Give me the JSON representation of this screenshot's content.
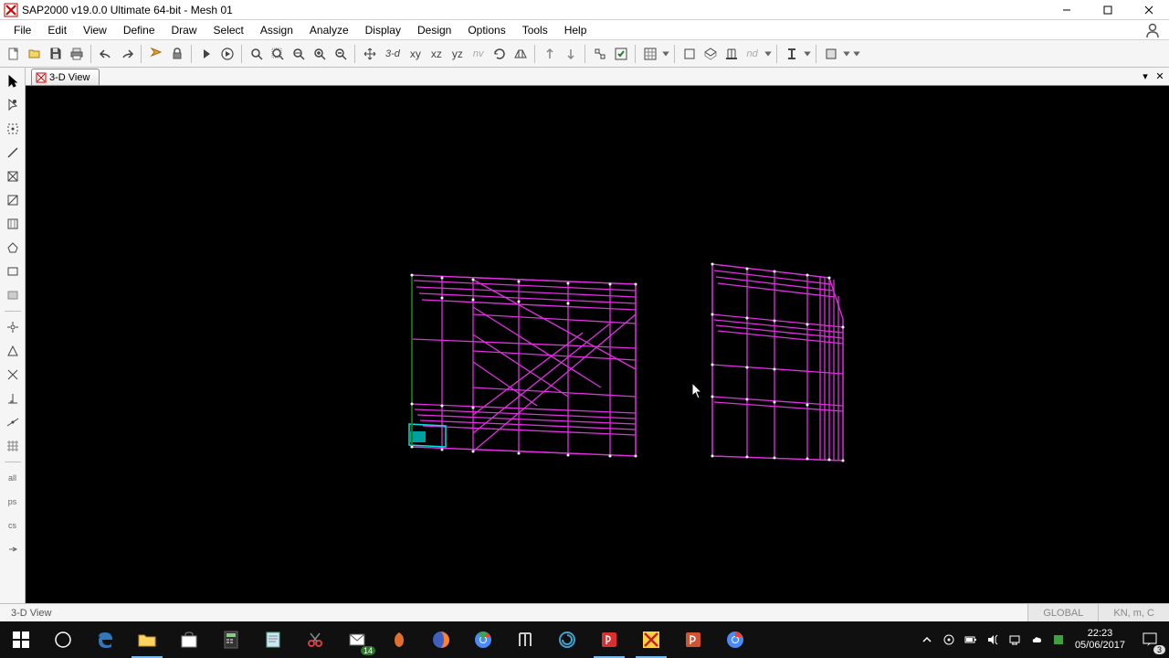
{
  "title": "SAP2000 v19.0.0 Ultimate 64-bit - Mesh 01",
  "menu": [
    "File",
    "Edit",
    "View",
    "Define",
    "Draw",
    "Select",
    "Assign",
    "Analyze",
    "Display",
    "Design",
    "Options",
    "Tools",
    "Help"
  ],
  "toolbar": {
    "view3d": "3-d",
    "xy": "xy",
    "xz": "xz",
    "yz": "yz",
    "nv": "nv",
    "nd": "nd"
  },
  "tabs": {
    "view3d": {
      "label": "3-D View"
    }
  },
  "status": {
    "left": "3-D View",
    "coord": "GLOBAL",
    "units": "KN, m, C"
  },
  "clock": {
    "time": "22:23",
    "date": "05/06/2017"
  },
  "notif_count": "3",
  "mail_badge": "14"
}
